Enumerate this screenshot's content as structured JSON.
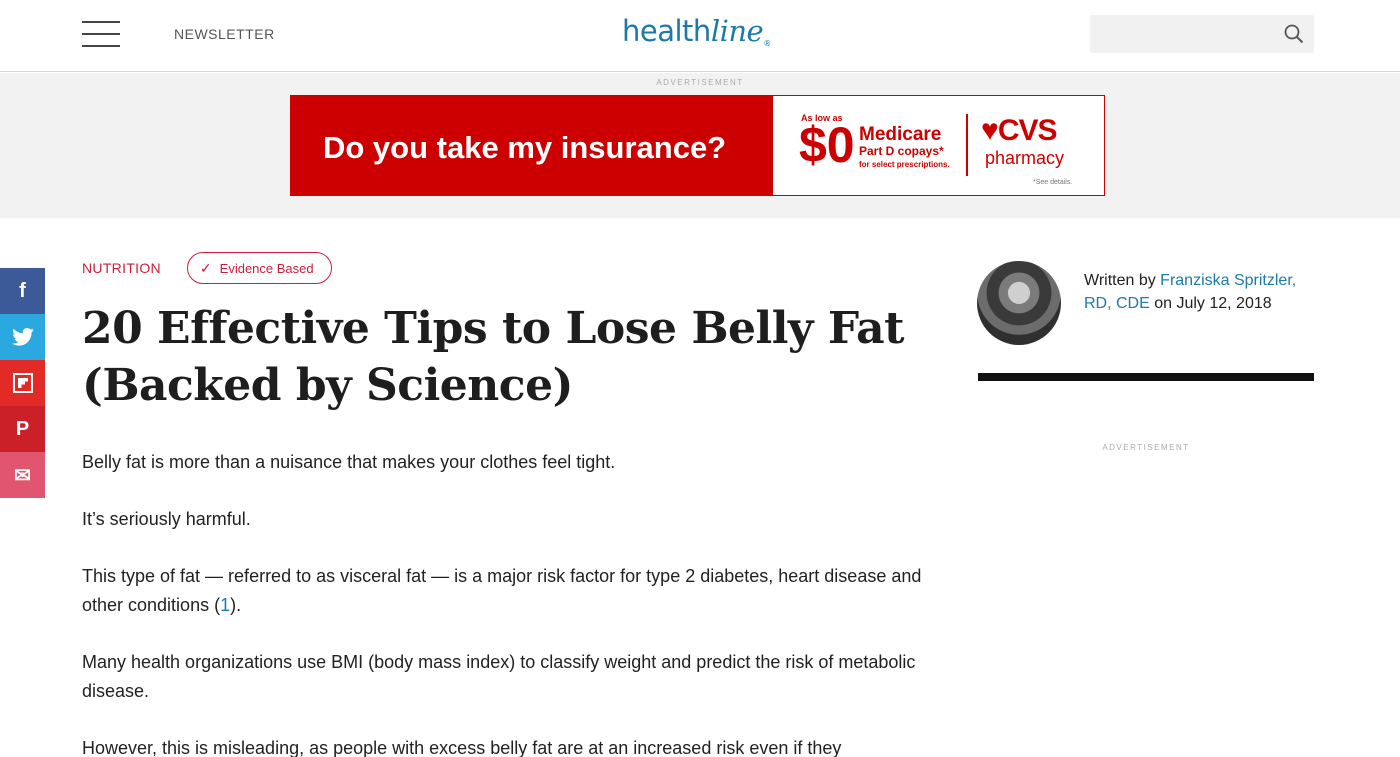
{
  "header": {
    "newsletter_label": "NEWSLETTER",
    "logo_main": "health",
    "logo_script": "line",
    "logo_mark": "®",
    "search_placeholder": ""
  },
  "ad": {
    "label": "ADVERTISEMENT",
    "headline": "Do you take my insurance?",
    "as_low_as": "As low as",
    "amount": "$0",
    "medicare": "Medicare",
    "part_d": "Part D copays*",
    "select": "for select prescriptions.",
    "brand": "♥CVS",
    "brand_sub": "pharmacy",
    "details": "*See details."
  },
  "share": {
    "facebook": "f",
    "twitter": "t",
    "flipboard": "F",
    "pinterest": "P",
    "email": "✉"
  },
  "article": {
    "category": "NUTRITION",
    "badge": "Evidence Based",
    "title": "20 Effective Tips to Lose Belly Fat (Backed by Science)",
    "p1": "Belly fat is more than a nuisance that makes your clothes feel tight.",
    "p2": "It’s seriously harmful.",
    "p3_text": "This type of fat — referred to as visceral fat — is a major risk factor for type 2 diabetes, heart disease and other conditions (",
    "p3_ref": "1",
    "p3_end": ").",
    "p4": "Many health organizations use BMI (body mass index) to classify weight and predict the risk of metabolic disease.",
    "p5": "However, this is misleading, as people with excess belly fat are at an increased risk even if they"
  },
  "author": {
    "written_by": "Written by ",
    "name": "Franziska Spritzler, RD, CDE",
    "on": " on July 12, 2018"
  },
  "sidebar": {
    "ad_label": "ADVERTISEMENT"
  },
  "colors": {
    "brand_blue": "#1d7aa8",
    "accent_red": "#cc1d3a",
    "ad_red": "#cc0000"
  }
}
